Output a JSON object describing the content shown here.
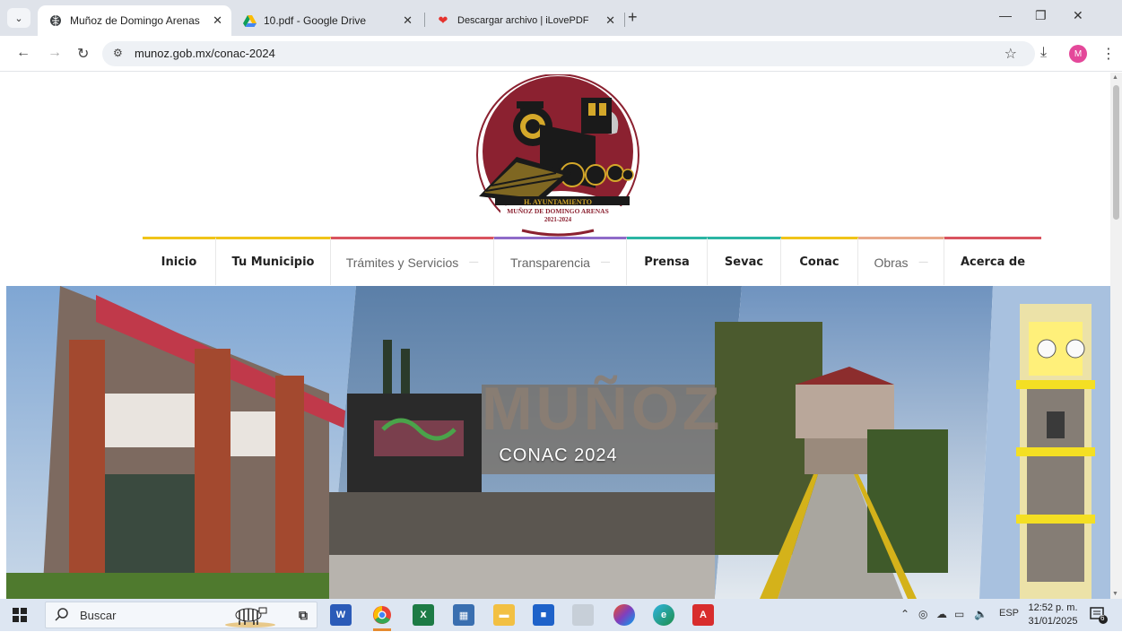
{
  "browser": {
    "tabs": [
      {
        "title": "Muñoz de Domingo Arenas",
        "active": true
      },
      {
        "title": "10.pdf - Google Drive",
        "active": false
      },
      {
        "title": "Descargar archivo | iLovePDF",
        "active": false
      }
    ],
    "url": "munoz.gob.mx/conac-2024",
    "profile_initial": "M"
  },
  "logo": {
    "line1": "H. AYUNTAMIENTO",
    "line2": "MUÑOZ DE DOMINGO ARENAS",
    "line3": "2021-2024"
  },
  "nav": {
    "items": [
      {
        "label": "Inicio",
        "color": "#f0c419",
        "dropdown": false
      },
      {
        "label": "Tu Municipio",
        "color": "#f0c419",
        "dropdown": false
      },
      {
        "label": "Trámites y Servicios",
        "color": "#d9535f",
        "dropdown": true
      },
      {
        "label": "Transparencia",
        "color": "#8e6bc9",
        "dropdown": true
      },
      {
        "label": "Prensa",
        "color": "#2bb5a3",
        "dropdown": false
      },
      {
        "label": "Sevac",
        "color": "#2bb5a3",
        "dropdown": false
      },
      {
        "label": "Conac",
        "color": "#f0c419",
        "dropdown": false
      },
      {
        "label": "Obras",
        "color": "#e8a98a",
        "dropdown": true
      },
      {
        "label": "Acerca de",
        "color": "#d9535f",
        "dropdown": false
      }
    ]
  },
  "hero": {
    "title": "CONAC 2024"
  },
  "taskbar": {
    "search_placeholder": "Buscar",
    "language": "ESP",
    "time": "12:52 p. m.",
    "date": "31/01/2025",
    "notifications": "6"
  }
}
